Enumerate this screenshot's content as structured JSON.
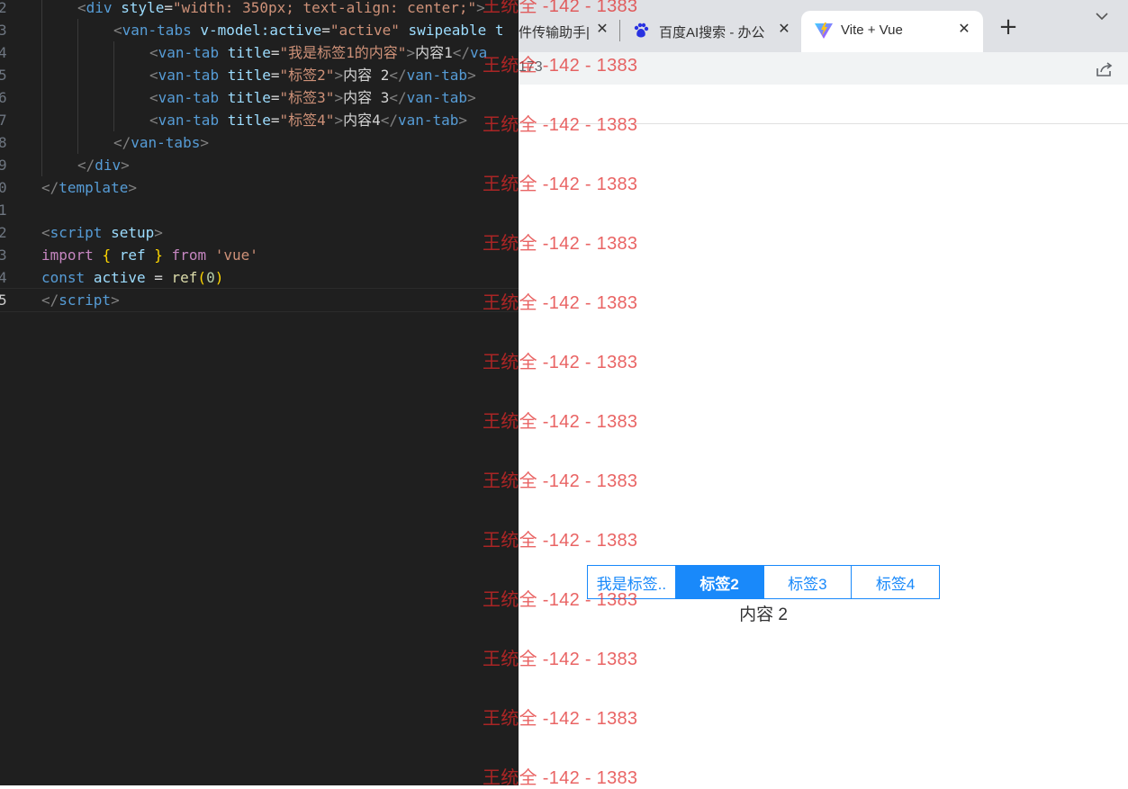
{
  "editor": {
    "lines": [
      {
        "n": "2",
        "indent": 2,
        "tokens": [
          [
            "t-p",
            "<"
          ],
          [
            "t-tag",
            "div"
          ],
          [
            "t-txt",
            " "
          ],
          [
            "t-attr",
            "style"
          ],
          [
            "t-txt",
            "="
          ],
          [
            "t-str",
            "\"width: 350px; text-align: center;\""
          ],
          [
            "t-p",
            ">"
          ]
        ]
      },
      {
        "n": "3",
        "indent": 3,
        "tokens": [
          [
            "t-p",
            "<"
          ],
          [
            "t-tag",
            "van-tabs"
          ],
          [
            "t-txt",
            " "
          ],
          [
            "t-attr",
            "v-model:active"
          ],
          [
            "t-txt",
            "="
          ],
          [
            "t-str",
            "\"active\""
          ],
          [
            "t-txt",
            " "
          ],
          [
            "t-attr",
            "swipeable"
          ],
          [
            "t-txt",
            " "
          ],
          [
            "t-attr",
            "t"
          ]
        ]
      },
      {
        "n": "4",
        "indent": 4,
        "tokens": [
          [
            "t-p",
            "<"
          ],
          [
            "t-tag",
            "van-tab"
          ],
          [
            "t-txt",
            " "
          ],
          [
            "t-attr",
            "title"
          ],
          [
            "t-txt",
            "="
          ],
          [
            "t-str",
            "\"我是标签1的内容\""
          ],
          [
            "t-p",
            ">"
          ],
          [
            "t-txt",
            "内容1"
          ],
          [
            "t-p",
            "</"
          ],
          [
            "t-tag",
            "va"
          ]
        ]
      },
      {
        "n": "5",
        "indent": 4,
        "tokens": [
          [
            "t-p",
            "<"
          ],
          [
            "t-tag",
            "van-tab"
          ],
          [
            "t-txt",
            " "
          ],
          [
            "t-attr",
            "title"
          ],
          [
            "t-txt",
            "="
          ],
          [
            "t-str",
            "\"标签2\""
          ],
          [
            "t-p",
            ">"
          ],
          [
            "t-txt",
            "内容 2"
          ],
          [
            "t-p",
            "</"
          ],
          [
            "t-tag",
            "van-tab"
          ],
          [
            "t-p",
            ">"
          ]
        ]
      },
      {
        "n": "6",
        "indent": 4,
        "tokens": [
          [
            "t-p",
            "<"
          ],
          [
            "t-tag",
            "van-tab"
          ],
          [
            "t-txt",
            " "
          ],
          [
            "t-attr",
            "title"
          ],
          [
            "t-txt",
            "="
          ],
          [
            "t-str",
            "\"标签3\""
          ],
          [
            "t-p",
            ">"
          ],
          [
            "t-txt",
            "内容 3"
          ],
          [
            "t-p",
            "</"
          ],
          [
            "t-tag",
            "van-tab"
          ],
          [
            "t-p",
            ">"
          ]
        ]
      },
      {
        "n": "7",
        "indent": 4,
        "tokens": [
          [
            "t-p",
            "<"
          ],
          [
            "t-tag",
            "van-tab"
          ],
          [
            "t-txt",
            " "
          ],
          [
            "t-attr",
            "title"
          ],
          [
            "t-txt",
            "="
          ],
          [
            "t-str",
            "\"标签4\""
          ],
          [
            "t-p",
            ">"
          ],
          [
            "t-txt",
            "内容4"
          ],
          [
            "t-p",
            "</"
          ],
          [
            "t-tag",
            "van-tab"
          ],
          [
            "t-p",
            ">"
          ]
        ]
      },
      {
        "n": "8",
        "indent": 3,
        "tokens": [
          [
            "t-p",
            "</"
          ],
          [
            "t-tag",
            "van-tabs"
          ],
          [
            "t-p",
            ">"
          ]
        ]
      },
      {
        "n": "9",
        "indent": 2,
        "tokens": [
          [
            "t-p",
            "</"
          ],
          [
            "t-tag",
            "div"
          ],
          [
            "t-p",
            ">"
          ]
        ]
      },
      {
        "n": "0",
        "indent": 1,
        "tokens": [
          [
            "t-p",
            "</"
          ],
          [
            "t-tag",
            "template"
          ],
          [
            "t-p",
            ">"
          ]
        ]
      },
      {
        "n": "1",
        "indent": 1,
        "tokens": []
      },
      {
        "n": "2",
        "indent": 1,
        "tokens": [
          [
            "t-p",
            "<"
          ],
          [
            "t-tag",
            "script"
          ],
          [
            "t-txt",
            " "
          ],
          [
            "t-attr",
            "setup"
          ],
          [
            "t-p",
            ">"
          ]
        ]
      },
      {
        "n": "3",
        "indent": 1,
        "tokens": [
          [
            "t-kw",
            "import"
          ],
          [
            "t-txt",
            " "
          ],
          [
            "t-br",
            "{"
          ],
          [
            "t-txt",
            " "
          ],
          [
            "t-attr",
            "ref"
          ],
          [
            "t-txt",
            " "
          ],
          [
            "t-br",
            "}"
          ],
          [
            "t-txt",
            " "
          ],
          [
            "t-kw",
            "from"
          ],
          [
            "t-txt",
            " "
          ],
          [
            "t-str",
            "'vue'"
          ]
        ]
      },
      {
        "n": "4",
        "indent": 1,
        "tokens": [
          [
            "t-kw2",
            "const"
          ],
          [
            "t-txt",
            " "
          ],
          [
            "t-attr",
            "active"
          ],
          [
            "t-txt",
            " = "
          ],
          [
            "t-fn",
            "ref"
          ],
          [
            "t-br",
            "("
          ],
          [
            "t-num",
            "0"
          ],
          [
            "t-br",
            ")"
          ]
        ]
      },
      {
        "n": "5",
        "indent": 1,
        "active": true,
        "tokens": [
          [
            "t-p",
            "</"
          ],
          [
            "t-tag",
            "script"
          ],
          [
            "t-p",
            ">"
          ]
        ]
      }
    ]
  },
  "browser": {
    "tabs": [
      {
        "title": "件传输助手|",
        "close": "✕"
      },
      {
        "title": "百度AI搜索 - 办公",
        "close": "✕",
        "icon": "baidu-paw-icon"
      },
      {
        "title": "Vite + Vue",
        "close": "✕",
        "icon": "vite-logo-icon",
        "active": true
      }
    ],
    "new_tab": "+",
    "tab_menu": "⌄",
    "address_fragment": "173",
    "van_tabs": {
      "items": [
        "我是标签..",
        "标签2",
        "标签3",
        "标签4"
      ],
      "active_index": 1,
      "content": "内容 2"
    }
  },
  "watermark": {
    "text": "王统全 -142 - 1383",
    "repeat": 14
  },
  "colors": {
    "editor_bg": "#1f1f1f",
    "vant_blue": "#1989fa",
    "watermark": "#e12828"
  }
}
